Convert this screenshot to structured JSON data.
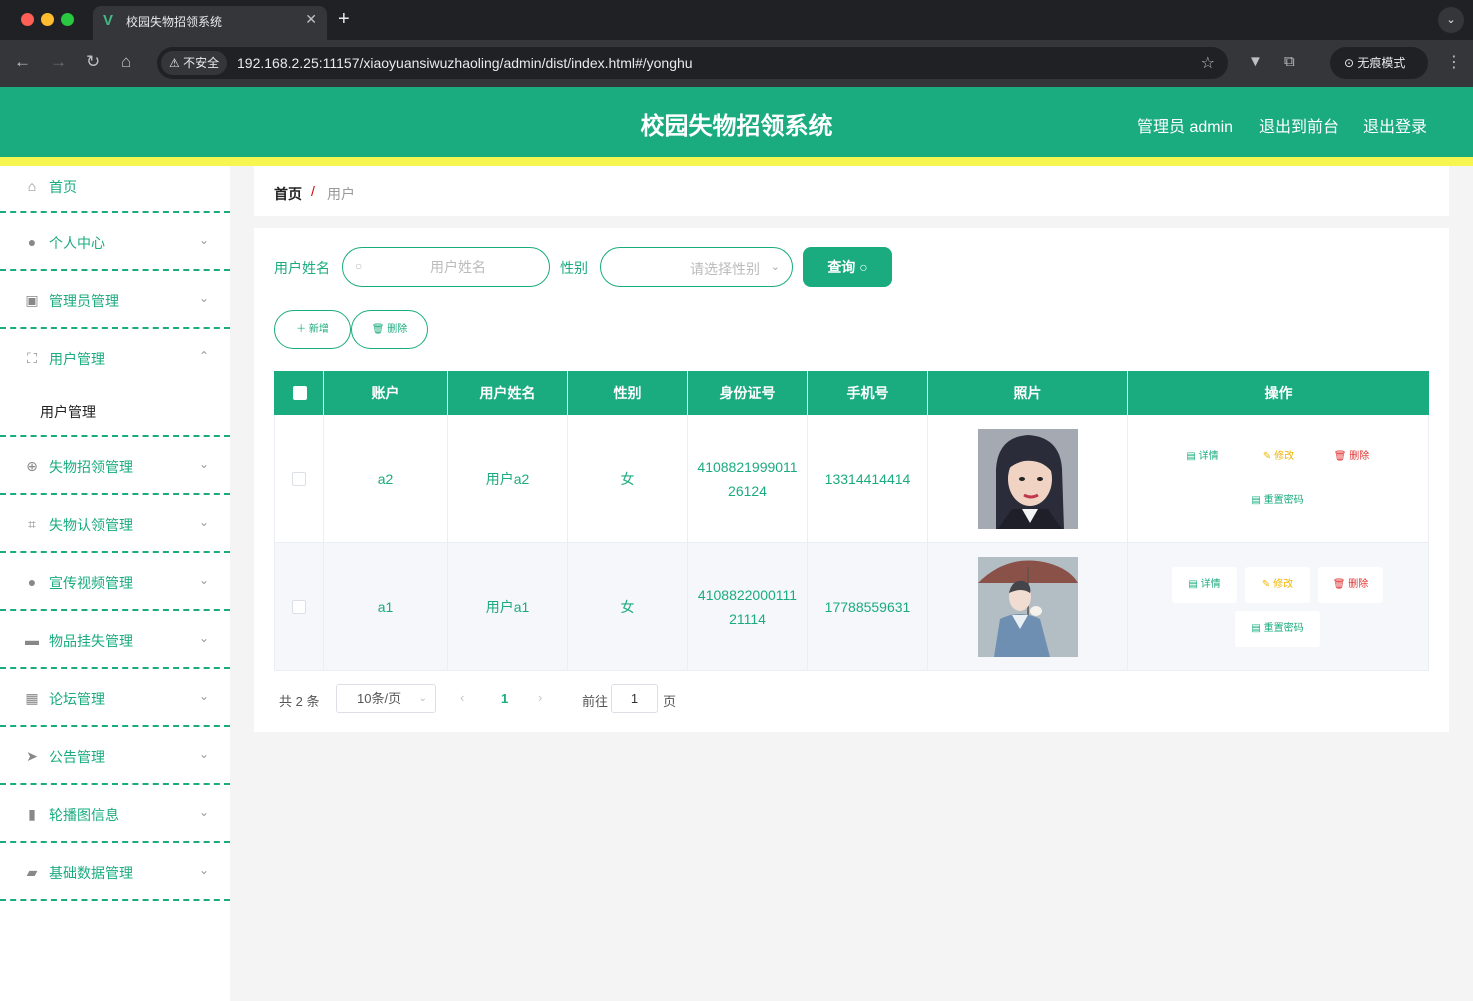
{
  "browser": {
    "tab_title": "校园失物招领系统",
    "tab_logo": "V",
    "new_tab": "+",
    "close": "✕",
    "security_label": "不安全",
    "url": "192.168.2.25:11157/xiaoyuansiwuzhaoling/admin/dist/index.html#/yonghu",
    "incognito_label": "无痕模式"
  },
  "header": {
    "title": "校园失物招领系统",
    "user": "管理员 admin",
    "to_front": "退出到前台",
    "logout": "退出登录"
  },
  "sidebar": {
    "items": [
      {
        "label": "首页",
        "icon": "home-icon"
      },
      {
        "label": "个人中心",
        "icon": "user-icon"
      },
      {
        "label": "管理员管理",
        "icon": "clipboard-icon"
      },
      {
        "label": "用户管理",
        "icon": "fullscreen-icon"
      },
      {
        "label": "失物招领管理",
        "icon": "crosshair-icon"
      },
      {
        "label": "失物认领管理",
        "icon": "crop-icon"
      },
      {
        "label": "宣传视频管理",
        "icon": "user-icon"
      },
      {
        "label": "物品挂失管理",
        "icon": "briefcase-icon"
      },
      {
        "label": "论坛管理",
        "icon": "grid-icon"
      },
      {
        "label": "公告管理",
        "icon": "send-icon"
      },
      {
        "label": "轮播图信息",
        "icon": "brush-icon"
      },
      {
        "label": "基础数据管理",
        "icon": "ticket-icon"
      }
    ],
    "submenu": {
      "label": "用户管理"
    }
  },
  "breadcrumb": {
    "home": "首页",
    "separator": "/",
    "current": "用户"
  },
  "search": {
    "name_label": "用户姓名",
    "name_placeholder": "用户姓名",
    "gender_label": "性别",
    "gender_placeholder": "请选择性别",
    "query_label": "查询"
  },
  "actions": {
    "add": "新增",
    "delete": "删除"
  },
  "table": {
    "headers": [
      "账户",
      "用户姓名",
      "性别",
      "身份证号",
      "手机号",
      "照片",
      "操作"
    ],
    "rows": [
      {
        "account": "a2",
        "name": "用户a2",
        "gender": "女",
        "id_number": "410882199901126124",
        "phone": "13314414414"
      },
      {
        "account": "a1",
        "name": "用户a1",
        "gender": "女",
        "id_number": "410882200011121114",
        "phone": "17788559631"
      }
    ],
    "ops": {
      "detail": "详情",
      "edit": "修改",
      "delete": "删除",
      "reset": "重置密码"
    }
  },
  "pagination": {
    "total": "共 2 条",
    "page_size": "10条/页",
    "current_page": "1",
    "goto_label": "前往",
    "goto_value": "1",
    "page_label": "页"
  },
  "colors": {
    "accent": "#1aab7e",
    "strip": "#f7f651",
    "edit": "#f0b400",
    "danger": "#e03030"
  }
}
